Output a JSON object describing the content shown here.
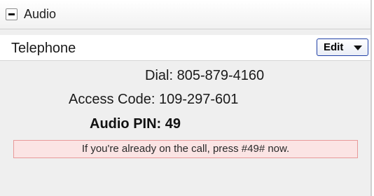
{
  "section": {
    "title": "Audio",
    "collapse_icon": "minus-icon"
  },
  "audio": {
    "mode_label": "Telephone",
    "edit_label": "Edit",
    "edit_icon": "caret-down-icon"
  },
  "details": {
    "dial_label": "Dial:",
    "dial_value": "805-879-4160",
    "access_label": "Access Code:",
    "access_value": "109-297-601",
    "pin_label": "Audio PIN:",
    "pin_value": "49"
  },
  "notice": {
    "text": "If you're already on the call, press #49# now."
  },
  "colors": {
    "panel_bg": "#efefef",
    "edit_border": "#1f3fa5",
    "notice_bg": "#fbe4e4",
    "notice_border": "#e89999"
  }
}
